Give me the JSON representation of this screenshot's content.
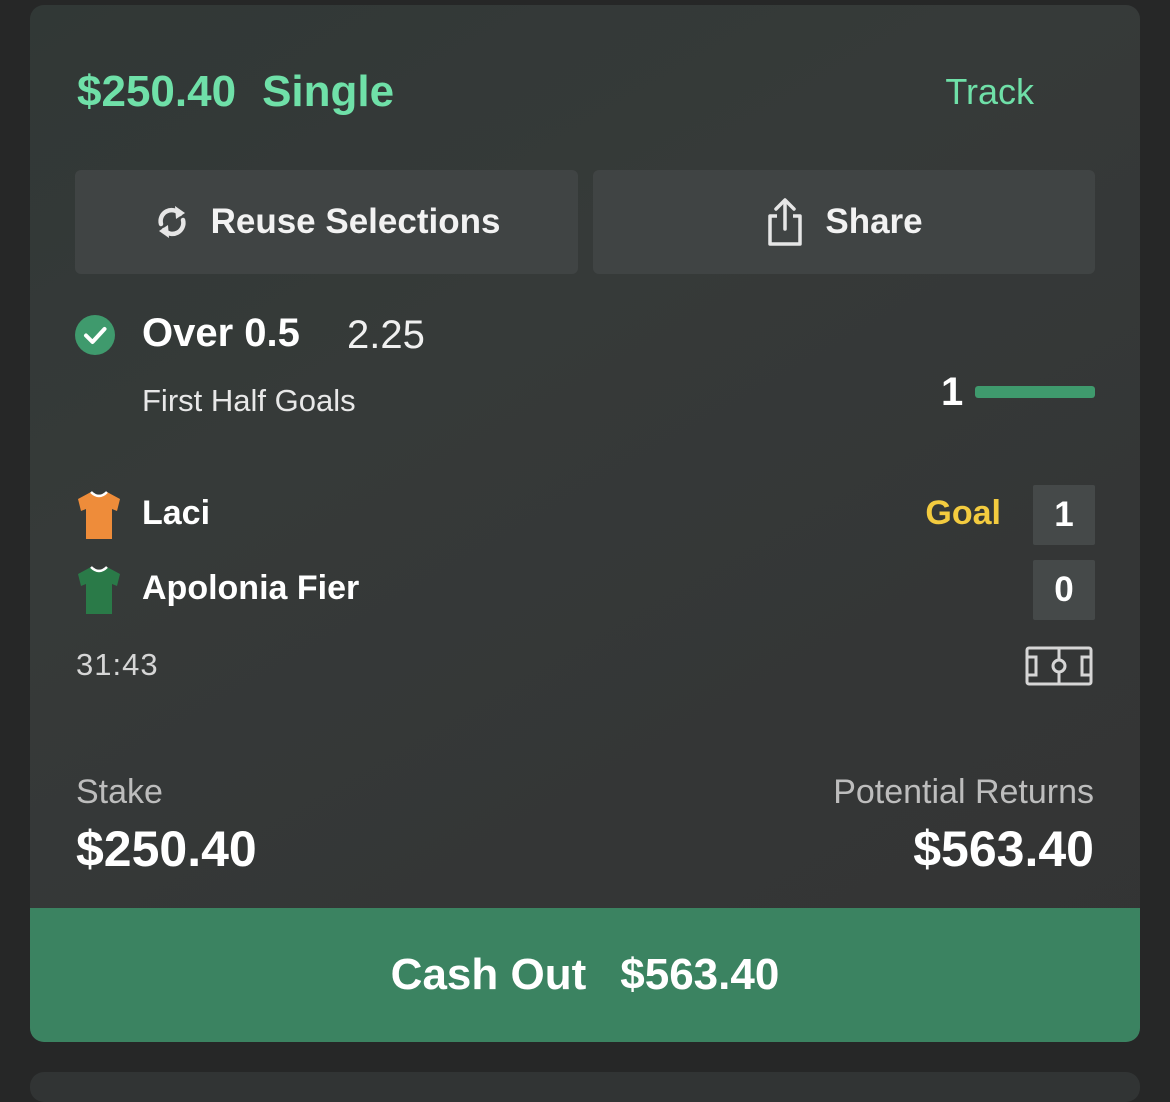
{
  "bet": {
    "amount": "$250.40",
    "type": "Single",
    "track_label": "Track"
  },
  "actions": {
    "reuse_label": "Reuse Selections",
    "reuse_icon": "refresh-icon",
    "share_label": "Share",
    "share_icon": "share-icon"
  },
  "selection": {
    "status_icon": "check-circle-icon",
    "name": "Over 0.5",
    "odds": "2.25",
    "market": "First Half Goals",
    "progress_value": "1",
    "progress_fraction": 1.0
  },
  "match": {
    "home": {
      "name": "Laci",
      "score": "1",
      "event": "Goal",
      "shirt_color": "#ee8c3a",
      "shirt_icon": "shirt-icon"
    },
    "away": {
      "name": "Apolonia Fier",
      "score": "0",
      "shirt_color": "#2a7a48",
      "shirt_icon": "shirt-icon"
    },
    "clock": "31:43",
    "pitch_icon": "pitch-icon"
  },
  "summary": {
    "stake_label": "Stake",
    "stake_value": "$250.40",
    "returns_label": "Potential Returns",
    "returns_value": "$563.40"
  },
  "cashout": {
    "label": "Cash Out",
    "amount": "$563.40"
  },
  "colors": {
    "accent_green": "#6fe0a8",
    "cashout_green": "#3b8361",
    "goal_yellow": "#f3cb3f",
    "background": "#262727"
  }
}
